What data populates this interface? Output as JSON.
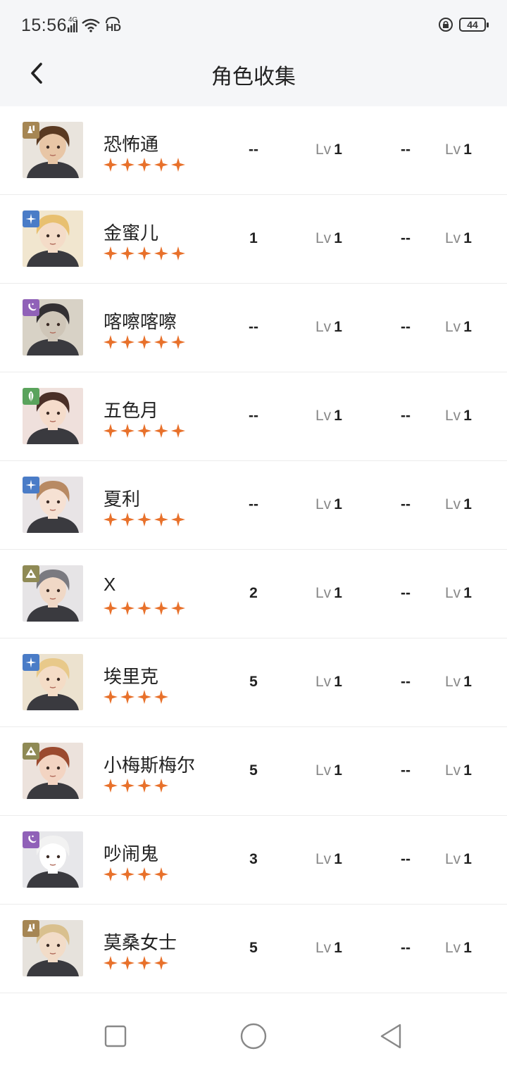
{
  "status_bar": {
    "time": "15:56",
    "network": "4G",
    "hd": "HD",
    "battery": "44"
  },
  "header": {
    "title": "角色收集",
    "back_icon": "chevron-left-icon"
  },
  "colors": {
    "star": "#e8712b",
    "badge_light": "#a68653",
    "badge_star": "#4a7cc7",
    "badge_moon": "#9061b8",
    "badge_leaf": "#5aa35c",
    "badge_triangle": "#8f8a55"
  },
  "characters": [
    {
      "name": "恐怖通",
      "stars": 5,
      "badge": "beaker-icon",
      "badge_color": "#a68653",
      "col1": "--",
      "lv_label": "Lv",
      "lv1": "1",
      "col3": "--",
      "lv2": "1",
      "hair": "#5a3a22",
      "skin": "#e8c6a6",
      "bg": "#e9e4dd"
    },
    {
      "name": "金蜜儿",
      "stars": 5,
      "badge": "sparkle-icon",
      "badge_color": "#4a7cc7",
      "col1": "1",
      "lv_label": "Lv",
      "lv1": "1",
      "col3": "--",
      "lv2": "1",
      "hair": "#e8c070",
      "skin": "#f4dcc8",
      "bg": "#f1e6cf"
    },
    {
      "name": "喀嚓喀嚓",
      "stars": 5,
      "badge": "moon-icon",
      "badge_color": "#9061b8",
      "col1": "--",
      "lv_label": "Lv",
      "lv1": "1",
      "col3": "--",
      "lv2": "1",
      "hair": "#333033",
      "skin": "#cfc6b8",
      "bg": "#d8d2c6"
    },
    {
      "name": "五色月",
      "stars": 5,
      "badge": "leaf-icon",
      "badge_color": "#5aa35c",
      "col1": "--",
      "lv_label": "Lv",
      "lv1": "1",
      "col3": "--",
      "lv2": "1",
      "hair": "#4a2f27",
      "skin": "#f5dccb",
      "bg": "#efe0dc"
    },
    {
      "name": "夏利",
      "stars": 5,
      "badge": "sparkle-icon",
      "badge_color": "#4a7cc7",
      "col1": "--",
      "lv_label": "Lv",
      "lv1": "1",
      "col3": "--",
      "lv2": "1",
      "hair": "#b88a63",
      "skin": "#f6e1d3",
      "bg": "#e8e4e6"
    },
    {
      "name": "X",
      "stars": 5,
      "badge": "triangle-icon",
      "badge_color": "#8f8a55",
      "col1": "2",
      "lv_label": "Lv",
      "lv1": "1",
      "col3": "--",
      "lv2": "1",
      "hair": "#7a7a80",
      "skin": "#f0d8c6",
      "bg": "#e6e4e6"
    },
    {
      "name": "埃里克",
      "stars": 4,
      "badge": "sparkle-icon",
      "badge_color": "#4a7cc7",
      "col1": "5",
      "lv_label": "Lv",
      "lv1": "1",
      "col3": "--",
      "lv2": "1",
      "hair": "#e8c98a",
      "skin": "#f4dcc6",
      "bg": "#ece2cf"
    },
    {
      "name": "小梅斯梅尔",
      "stars": 4,
      "badge": "triangle-icon",
      "badge_color": "#8f8a55",
      "col1": "5",
      "lv_label": "Lv",
      "lv1": "1",
      "col3": "--",
      "lv2": "1",
      "hair": "#9b4a2f",
      "skin": "#f3d4c2",
      "bg": "#ece2dc"
    },
    {
      "name": "吵闹鬼",
      "stars": 4,
      "badge": "moon-icon",
      "badge_color": "#9061b8",
      "col1": "3",
      "lv_label": "Lv",
      "lv1": "1",
      "col3": "--",
      "lv2": "1",
      "hair": "#f2f2f2",
      "skin": "#ffffff",
      "bg": "#e7e7ea"
    },
    {
      "name": "莫桑女士",
      "stars": 4,
      "badge": "beaker-icon",
      "badge_color": "#a68653",
      "col1": "5",
      "lv_label": "Lv",
      "lv1": "1",
      "col3": "--",
      "lv2": "1",
      "hair": "#d9c08e",
      "skin": "#f2dcc8",
      "bg": "#e6e2dc"
    }
  ],
  "bottom_nav": [
    "square-icon",
    "circle-icon",
    "triangle-back-icon"
  ]
}
